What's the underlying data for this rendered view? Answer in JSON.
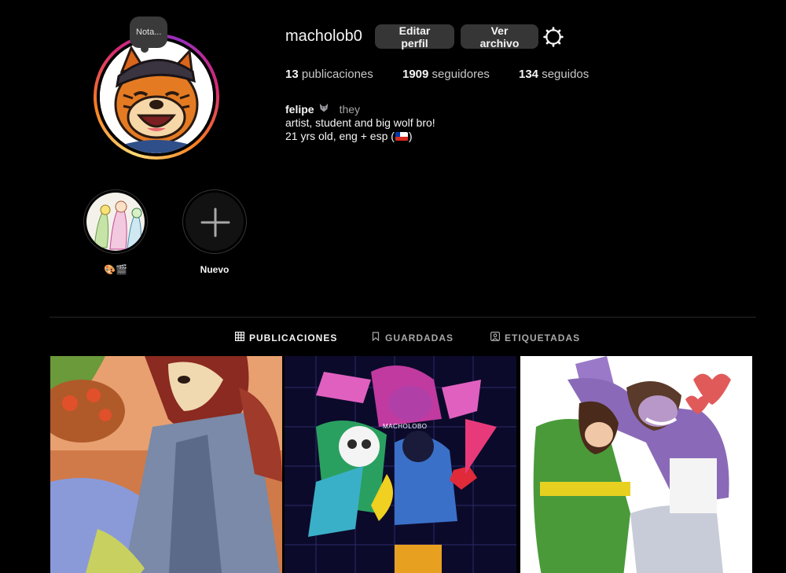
{
  "profile": {
    "username": "macholob0",
    "note": "Nota...",
    "edit_button": "Editar perfil",
    "archive_button": "Ver archivo",
    "settings_icon": "gear-icon"
  },
  "stats": {
    "posts_count": "13",
    "posts_label": "publicaciones",
    "followers_count": "1909",
    "followers_label": "seguidores",
    "following_count": "134",
    "following_label": "seguidos"
  },
  "bio": {
    "name": "felipe",
    "name_emoji_icon": "wolf-icon",
    "pronouns": "they",
    "line1": "artist, student and big wolf bro!",
    "line2_prefix": "21 yrs old, eng + esp (",
    "line2_flag_icon": "chile-flag-icon",
    "line2_suffix": ")"
  },
  "highlights": [
    {
      "label": "🎨🎬",
      "type": "story"
    },
    {
      "label": "Nuevo",
      "type": "new"
    }
  ],
  "tabs": [
    {
      "label": "PUBLICACIONES",
      "icon": "grid-icon",
      "active": true
    },
    {
      "label": "GUARDADAS",
      "icon": "bookmark-icon",
      "active": false
    },
    {
      "label": "ETIQUETADAS",
      "icon": "tag-icon",
      "active": false
    }
  ],
  "posts": [
    {
      "name": "bear-overalls-artwork"
    },
    {
      "name": "deltarune-group-artwork",
      "watermark": "MACHOLOBO"
    },
    {
      "name": "kris-susie-artwork"
    }
  ],
  "colors": {
    "background": "#000000",
    "button_bg": "#363636",
    "muted_text": "#a8a8a8",
    "divider": "#262626"
  }
}
